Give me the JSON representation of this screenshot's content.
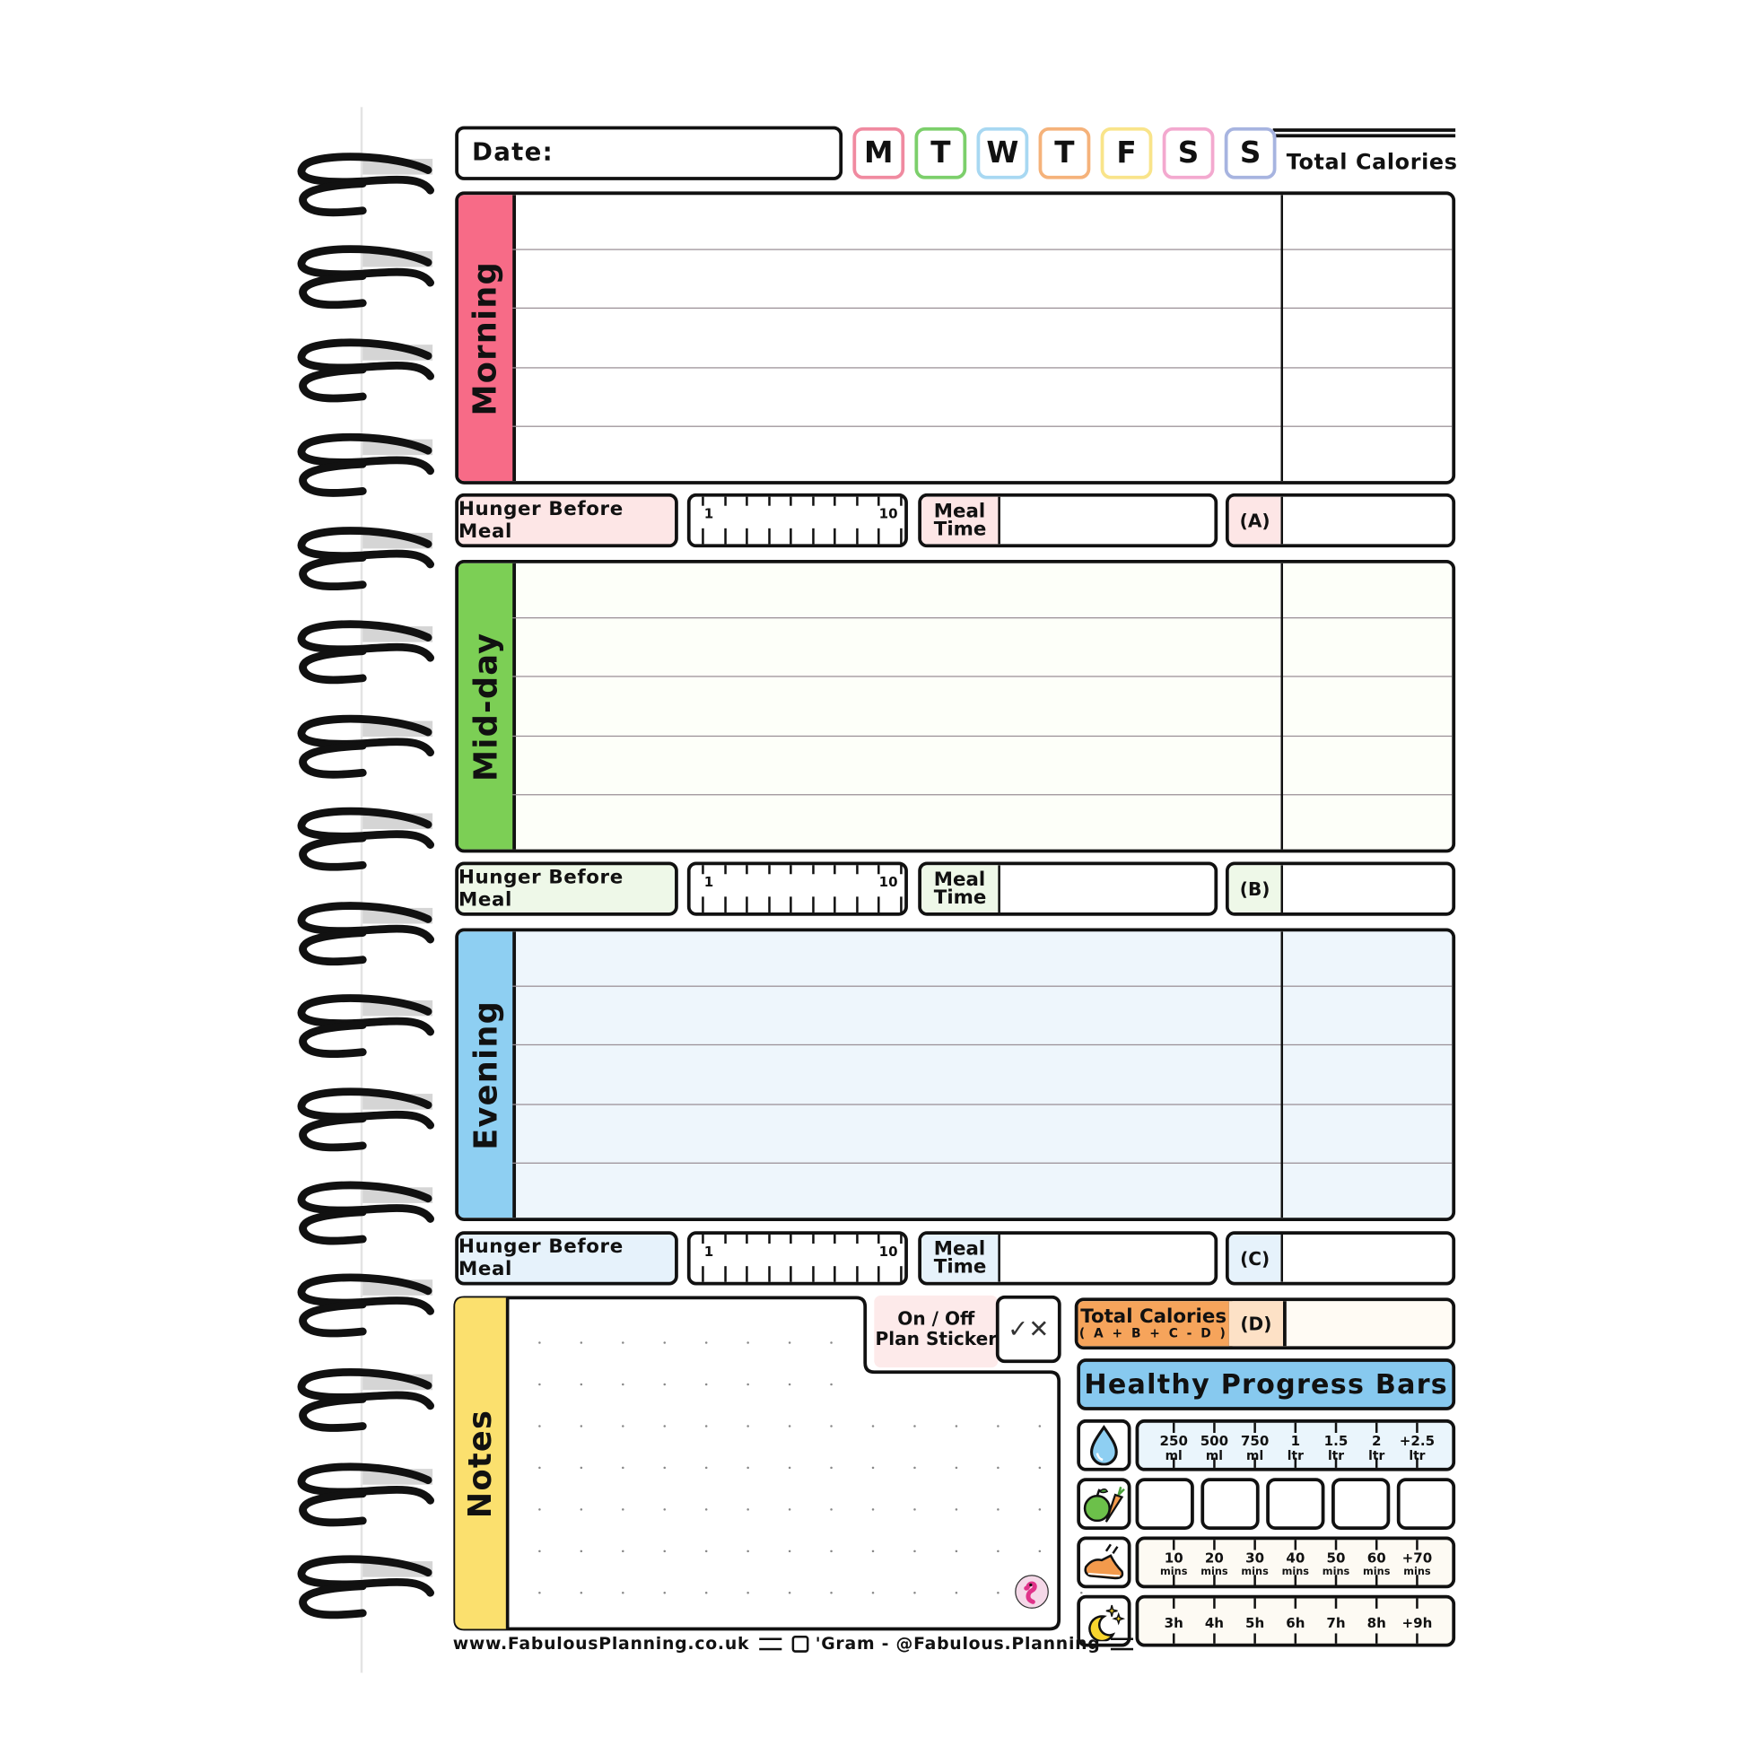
{
  "header": {
    "date_label": "Date:",
    "days": [
      {
        "label": "M",
        "color": "#f08aa0"
      },
      {
        "label": "T",
        "color": "#7ccf6b"
      },
      {
        "label": "W",
        "color": "#a8d8f2"
      },
      {
        "label": "T",
        "color": "#f5b27a"
      },
      {
        "label": "F",
        "color": "#f9e48a"
      },
      {
        "label": "S",
        "color": "#f3a9cf"
      },
      {
        "label": "S",
        "color": "#a7b4e0"
      }
    ],
    "total_calories_label": "Total Calories"
  },
  "sections": [
    {
      "label": "Morning",
      "color": "#f76b87",
      "bg": "#ffffff",
      "hunger_bg": "#fde6e6",
      "calorie_tag": "(A)"
    },
    {
      "label": "Mid-day",
      "color": "#7ccf55",
      "bg": "#fdfff9",
      "hunger_bg": "#eef8e8",
      "calorie_tag": "(B)"
    },
    {
      "label": "Evening",
      "color": "#8ecff2",
      "bg": "#eef6fc",
      "hunger_bg": "#e6f2fb",
      "calorie_tag": "(C)"
    }
  ],
  "meal_row": {
    "hunger_label": "Hunger Before Meal",
    "scale_min": "1",
    "scale_max": "10",
    "meal_time_line1": "Meal",
    "meal_time_line2": "Time"
  },
  "notes": {
    "label": "Notes",
    "color": "#fbe06e",
    "sticker_line1": "On / Off",
    "sticker_line2": "Plan Sticker",
    "check_x": "✓✕"
  },
  "total": {
    "line1": "Total Calories",
    "line2": "( A + B + C - D )",
    "tag": "(D)",
    "color": "#f6a45b",
    "tag_bg": "#fde1c6"
  },
  "progress": {
    "title": "Healthy Progress Bars",
    "water": {
      "icon": "water-drop-icon",
      "bg": "#eaf5fc",
      "labels": [
        [
          "250",
          "ml"
        ],
        [
          "500",
          "ml"
        ],
        [
          "750",
          "ml"
        ],
        [
          "1",
          "ltr"
        ],
        [
          "1.5",
          "ltr"
        ],
        [
          "2",
          "ltr"
        ],
        [
          "+2.5",
          "ltr"
        ]
      ]
    },
    "fruit_veg": {
      "icon": "apple-carrot-icon",
      "boxes": 5
    },
    "exercise": {
      "icon": "running-shoe-icon",
      "bg": "#fdfaf3",
      "labels": [
        [
          "10",
          "mins"
        ],
        [
          "20",
          "mins"
        ],
        [
          "30",
          "mins"
        ],
        [
          "40",
          "mins"
        ],
        [
          "50",
          "mins"
        ],
        [
          "60",
          "mins"
        ],
        [
          "+70",
          "mins"
        ]
      ]
    },
    "sleep": {
      "icon": "moon-stars-icon",
      "bg": "#fdfaf3",
      "labels": [
        [
          "3h",
          ""
        ],
        [
          "4h",
          ""
        ],
        [
          "5h",
          ""
        ],
        [
          "6h",
          ""
        ],
        [
          "7h",
          ""
        ],
        [
          "8h",
          ""
        ],
        [
          "+9h",
          ""
        ]
      ]
    }
  },
  "footer": {
    "website": "www.FabulousPlanning.co.uk",
    "instagram": "'Gram - @Fabulous.Planning"
  }
}
